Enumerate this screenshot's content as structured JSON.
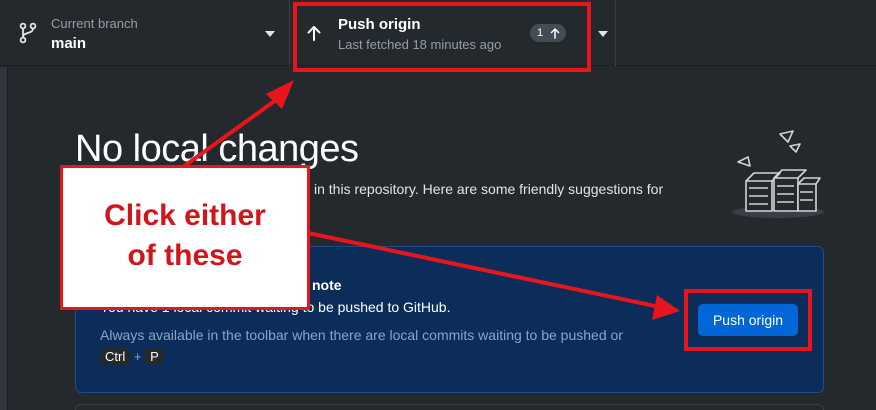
{
  "toolbar": {
    "branch": {
      "label": "Current branch",
      "name": "main"
    },
    "push": {
      "title": "Push origin",
      "subtitle": "Last fetched 18 minutes ago",
      "badge_count": "1"
    }
  },
  "main": {
    "heading": "No local changes",
    "intro_visible": "in this repository. Here are some friendly suggestions for",
    "card": {
      "title_visible": "note",
      "description_visible": "You have 1 local commit waiting to be pushed to GitHub.",
      "hint": "Always available in the toolbar when there are local commits waiting to be pushed or",
      "shortcut": {
        "key1": "Ctrl",
        "plus": "+",
        "key2": "P"
      },
      "button_label": "Push origin"
    }
  },
  "annotation": {
    "callout_line1": "Click either",
    "callout_line2": "of these",
    "color": "#e8161c"
  },
  "icons": [
    "git-branch-icon",
    "arrow-up-icon",
    "chevron-down-icon",
    "empty-repository-illustration"
  ]
}
